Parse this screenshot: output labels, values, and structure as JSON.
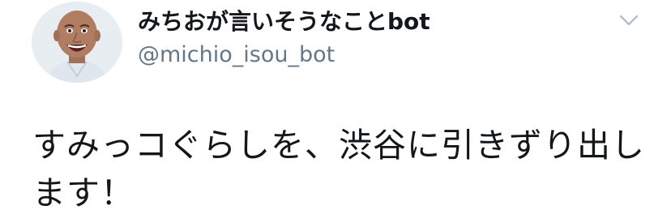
{
  "tweet": {
    "author": {
      "display_name": "みちおが言いそうなことbot",
      "handle": "@michio_isou_bot",
      "avatar_icon": "avatar-photo-icon"
    },
    "menu_icon": "chevron-down-icon",
    "text": "すみっコぐらしを、渋谷に引きずり出します！"
  },
  "colors": {
    "name_text": "#14171a",
    "handle_text": "#657786",
    "caret": "#aab8c2",
    "background": "#ffffff"
  }
}
